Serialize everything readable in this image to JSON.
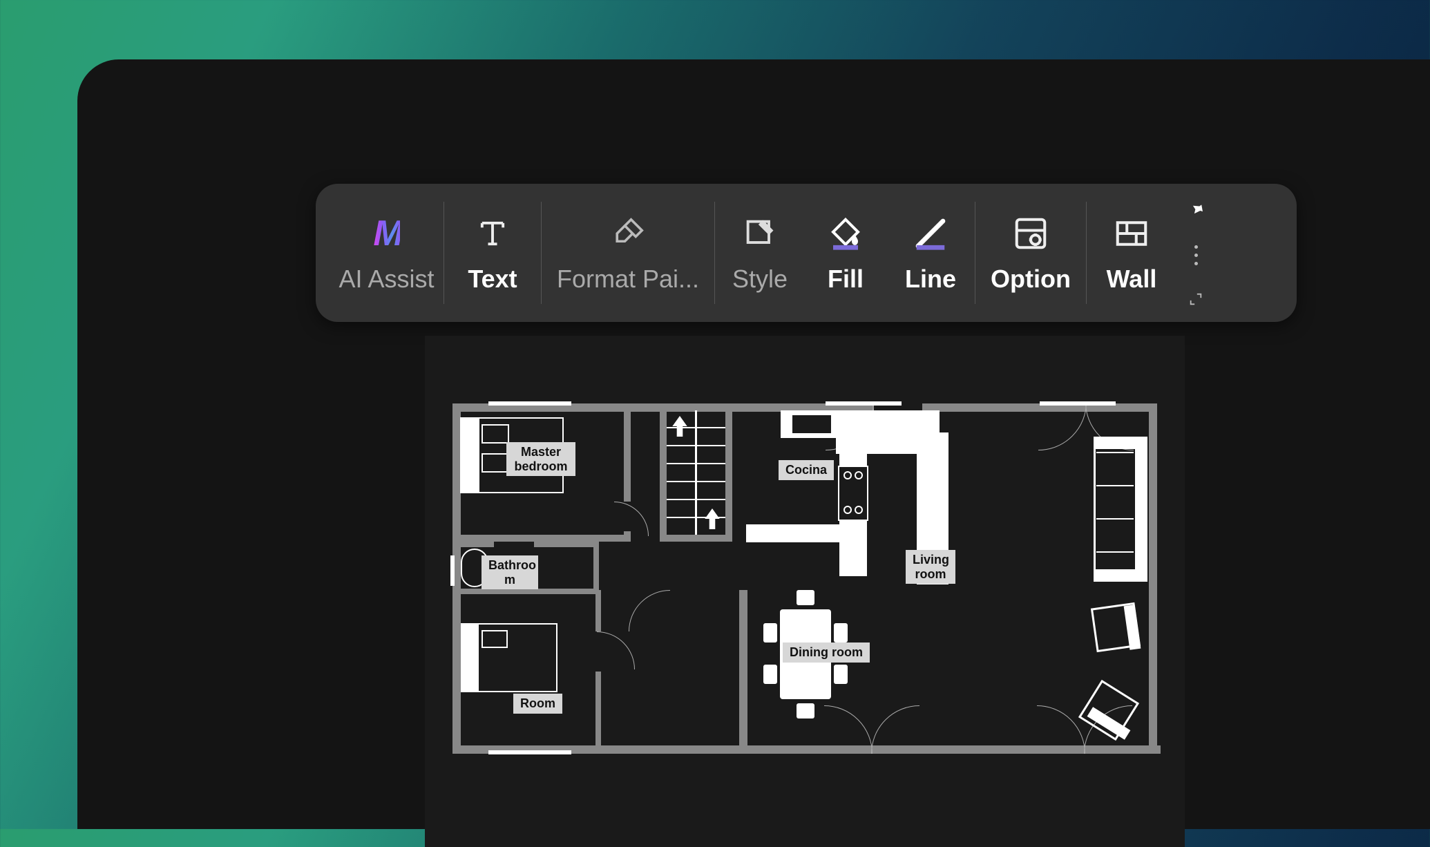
{
  "toolbar": {
    "ai_assist": "AI Assist",
    "text": "Text",
    "format_painter": "Format Pai...",
    "style": "Style",
    "fill": "Fill",
    "line": "Line",
    "option": "Option",
    "wall": "Wall"
  },
  "floorplan": {
    "labels": {
      "master_bedroom": "Master bedroom",
      "bathroom": "Bathroo m",
      "room": "Room",
      "cocina": "Cocina",
      "dining_room": "Dining room",
      "living_room": "Living room"
    }
  }
}
